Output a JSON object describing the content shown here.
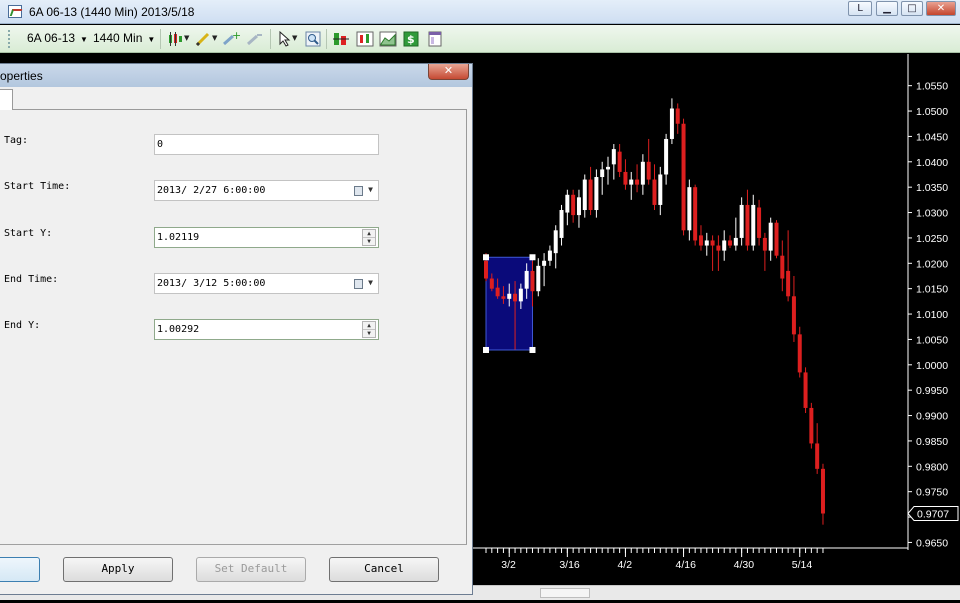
{
  "window": {
    "title": "6A 06-13 (1440 Min)  2013/5/18",
    "btn_L": "L",
    "btn_min": "▁",
    "btn_max": "□",
    "btn_close": "✕"
  },
  "toolbar": {
    "symbol": "6A 06-13",
    "interval": "1440 Min",
    "icons": [
      "candlestick-icon",
      "pencil-icon",
      "add-indicator-icon",
      "remove-indicator-icon",
      "cursor-icon",
      "zoom-icon",
      "bar-style-icon",
      "chart-style-icon",
      "area-chart-icon",
      "dollar-icon",
      "panel-icon"
    ]
  },
  "dialog": {
    "title": "operties",
    "close": "✕",
    "fields": {
      "tag": {
        "label": "Tag:",
        "value": "0"
      },
      "start_time": {
        "label": "Start Time:",
        "value": "2013/ 2/27  6:00:00"
      },
      "start_y": {
        "label": "Start Y:",
        "value": "1.02119"
      },
      "end_time": {
        "label": "End Time:",
        "value": "2013/ 3/12  5:00:00"
      },
      "end_y": {
        "label": "End Y:",
        "value": "1.00292"
      }
    },
    "buttons": {
      "apply": "Apply",
      "set_default": "Set Default",
      "cancel": "Cancel",
      "ok": ""
    }
  },
  "colors": {
    "up": "#ffffff",
    "down": "#dd1f1f",
    "rect_fill": "#0a0a7a",
    "rect_border": "#3f59d6"
  },
  "chart_data": {
    "type": "candlestick",
    "instrument": "6A 06-13",
    "timeframe": "1440 Min",
    "ylim": [
      0.9641,
      1.0573
    ],
    "ytick_labels": [
      "1.0550",
      "1.0500",
      "1.0450",
      "1.0400",
      "1.0350",
      "1.0300",
      "1.0250",
      "1.0200",
      "1.0150",
      "1.0100",
      "1.0050",
      "1.0000",
      "0.9950",
      "0.9900",
      "0.9850",
      "0.9800",
      "0.9750",
      "0.9700",
      "0.9650"
    ],
    "ytick_values": [
      1.055,
      1.05,
      1.045,
      1.04,
      1.035,
      1.03,
      1.025,
      1.02,
      1.015,
      1.01,
      1.005,
      1.0,
      0.995,
      0.99,
      0.985,
      0.98,
      0.975,
      0.97,
      0.965
    ],
    "xtick_labels": [
      "3/2",
      "3/16",
      "4/2",
      "4/16",
      "4/30",
      "5/14"
    ],
    "xtick_bar_index": [
      4,
      14,
      24,
      34,
      44,
      54
    ],
    "last_price": "0.9707",
    "candles": [
      {
        "o": 1.0205,
        "h": 1.022,
        "l": 1.0165,
        "c": 1.017
      },
      {
        "o": 1.017,
        "h": 1.018,
        "l": 1.0145,
        "c": 1.015
      },
      {
        "o": 1.0152,
        "h": 1.017,
        "l": 1.013,
        "c": 1.0135
      },
      {
        "o": 1.0135,
        "h": 1.0155,
        "l": 1.012,
        "c": 1.013
      },
      {
        "o": 1.013,
        "h": 1.016,
        "l": 1.0115,
        "c": 1.014
      },
      {
        "o": 1.014,
        "h": 1.0165,
        "l": 1.003,
        "c": 1.0125
      },
      {
        "o": 1.0125,
        "h": 1.016,
        "l": 1.011,
        "c": 1.015
      },
      {
        "o": 1.015,
        "h": 1.02,
        "l": 1.013,
        "c": 1.0185
      },
      {
        "o": 1.0185,
        "h": 1.0205,
        "l": 1.0115,
        "c": 1.0145
      },
      {
        "o": 1.0145,
        "h": 1.021,
        "l": 1.0135,
        "c": 1.0195
      },
      {
        "o": 1.0195,
        "h": 1.022,
        "l": 1.0155,
        "c": 1.0205
      },
      {
        "o": 1.0205,
        "h": 1.0235,
        "l": 1.0195,
        "c": 1.0225
      },
      {
        "o": 1.022,
        "h": 1.0275,
        "l": 1.019,
        "c": 1.0265
      },
      {
        "o": 1.025,
        "h": 1.0315,
        "l": 1.0235,
        "c": 1.0305
      },
      {
        "o": 1.03,
        "h": 1.0345,
        "l": 1.0275,
        "c": 1.0335
      },
      {
        "o": 1.0335,
        "h": 1.0345,
        "l": 1.028,
        "c": 1.0295
      },
      {
        "o": 1.0295,
        "h": 1.0345,
        "l": 1.027,
        "c": 1.033
      },
      {
        "o": 1.0305,
        "h": 1.0375,
        "l": 1.029,
        "c": 1.0365
      },
      {
        "o": 1.0365,
        "h": 1.039,
        "l": 1.0295,
        "c": 1.0305
      },
      {
        "o": 1.0305,
        "h": 1.0385,
        "l": 1.029,
        "c": 1.037
      },
      {
        "o": 1.037,
        "h": 1.04,
        "l": 1.0335,
        "c": 1.0385
      },
      {
        "o": 1.0385,
        "h": 1.041,
        "l": 1.0355,
        "c": 1.039
      },
      {
        "o": 1.0395,
        "h": 1.0435,
        "l": 1.0365,
        "c": 1.0425
      },
      {
        "o": 1.042,
        "h": 1.0435,
        "l": 1.037,
        "c": 1.038
      },
      {
        "o": 1.038,
        "h": 1.0405,
        "l": 1.0345,
        "c": 1.0355
      },
      {
        "o": 1.0355,
        "h": 1.038,
        "l": 1.0325,
        "c": 1.0365
      },
      {
        "o": 1.0365,
        "h": 1.0395,
        "l": 1.034,
        "c": 1.0355
      },
      {
        "o": 1.0355,
        "h": 1.0415,
        "l": 1.0335,
        "c": 1.04
      },
      {
        "o": 1.04,
        "h": 1.0445,
        "l": 1.0355,
        "c": 1.0365
      },
      {
        "o": 1.0365,
        "h": 1.0395,
        "l": 1.0305,
        "c": 1.0315
      },
      {
        "o": 1.0315,
        "h": 1.039,
        "l": 1.0295,
        "c": 1.0375
      },
      {
        "o": 1.0375,
        "h": 1.0455,
        "l": 1.0355,
        "c": 1.0445
      },
      {
        "o": 1.0445,
        "h": 1.0525,
        "l": 1.0435,
        "c": 1.0505
      },
      {
        "o": 1.0505,
        "h": 1.0515,
        "l": 1.0455,
        "c": 1.0475
      },
      {
        "o": 1.0475,
        "h": 1.0485,
        "l": 1.0255,
        "c": 1.0265
      },
      {
        "o": 1.0265,
        "h": 1.0365,
        "l": 1.0245,
        "c": 1.035
      },
      {
        "o": 1.035,
        "h": 1.0355,
        "l": 1.0235,
        "c": 1.0245
      },
      {
        "o": 1.0255,
        "h": 1.0275,
        "l": 1.0225,
        "c": 1.0235
      },
      {
        "o": 1.0235,
        "h": 1.026,
        "l": 1.0215,
        "c": 1.0245
      },
      {
        "o": 1.0245,
        "h": 1.0255,
        "l": 1.0185,
        "c": 1.0235
      },
      {
        "o": 1.0235,
        "h": 1.0255,
        "l": 1.0185,
        "c": 1.0225
      },
      {
        "o": 1.0225,
        "h": 1.0265,
        "l": 1.0205,
        "c": 1.0245
      },
      {
        "o": 1.0245,
        "h": 1.0255,
        "l": 1.023,
        "c": 1.0235
      },
      {
        "o": 1.0235,
        "h": 1.029,
        "l": 1.0225,
        "c": 1.025
      },
      {
        "o": 1.025,
        "h": 1.033,
        "l": 1.0235,
        "c": 1.0315
      },
      {
        "o": 1.0315,
        "h": 1.0345,
        "l": 1.0225,
        "c": 1.0235
      },
      {
        "o": 1.0235,
        "h": 1.0335,
        "l": 1.0225,
        "c": 1.0315
      },
      {
        "o": 1.031,
        "h": 1.0325,
        "l": 1.0235,
        "c": 1.025
      },
      {
        "o": 1.025,
        "h": 1.026,
        "l": 1.0185,
        "c": 1.0225
      },
      {
        "o": 1.0225,
        "h": 1.029,
        "l": 1.0205,
        "c": 1.028
      },
      {
        "o": 1.028,
        "h": 1.0285,
        "l": 1.021,
        "c": 1.0215
      },
      {
        "o": 1.0215,
        "h": 1.0245,
        "l": 1.0145,
        "c": 1.017
      },
      {
        "o": 1.0185,
        "h": 1.0265,
        "l": 1.0125,
        "c": 1.0135
      },
      {
        "o": 1.0135,
        "h": 1.0175,
        "l": 1.0045,
        "c": 1.006
      },
      {
        "o": 1.006,
        "h": 1.0075,
        "l": 0.9975,
        "c": 0.9985
      },
      {
        "o": 0.9985,
        "h": 0.9995,
        "l": 0.9905,
        "c": 0.9915
      },
      {
        "o": 0.9915,
        "h": 0.9925,
        "l": 0.9835,
        "c": 0.9845
      },
      {
        "o": 0.9845,
        "h": 0.9885,
        "l": 0.9785,
        "c": 0.9795
      },
      {
        "o": 0.9795,
        "h": 0.9805,
        "l": 0.9685,
        "c": 0.9707
      }
    ],
    "drawing": {
      "type": "rectangle",
      "start_bar": 0,
      "end_bar": 8,
      "y1": 1.02119,
      "y2": 1.00292
    }
  }
}
